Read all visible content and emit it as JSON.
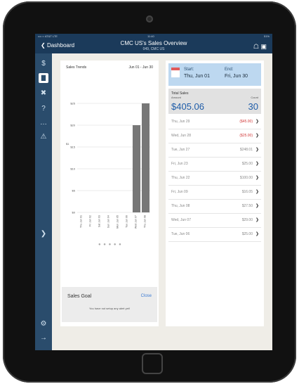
{
  "status_bar": {
    "carrier": "•••○○ AT&T  LTE",
    "time": "11:40",
    "battery": "51%"
  },
  "nav": {
    "back_label": "Dashboard",
    "title": "CMC US's Sales Overview",
    "subtitle": "049, CMC US",
    "icons": [
      "network-icon",
      "export-icon"
    ]
  },
  "sidebar": {
    "items": [
      "dollar-icon",
      "chart-icon",
      "tools-icon",
      "help-icon",
      "more-icon",
      "alert-icon",
      "settings-icon",
      "logout-icon"
    ]
  },
  "chart": {
    "title": "Sales Trends",
    "range": "Jun 01 - Jun 30",
    "y_axis_label": "$1"
  },
  "chart_data": {
    "type": "bar",
    "categories": [
      "Thu Jun 01",
      "Fri Jun 02",
      "Sat Jun 03",
      "Sun Jun 04",
      "Mon Jun 05",
      "Tue Jun 06",
      "Wed Jun 07",
      "Thu Jun 08"
    ],
    "values": [
      0,
      0,
      0,
      0,
      0,
      0,
      20,
      25
    ],
    "y_ticks": [
      "$0",
      "$5",
      "$10",
      "$15",
      "$20",
      "$25"
    ],
    "ylim": [
      0,
      30
    ],
    "color": "#777777"
  },
  "sales_goal": {
    "label": "Sales Goal",
    "close_label": "Close",
    "message": "You have not setup any alert yet!"
  },
  "date_range": {
    "start_label": "Start:",
    "start_value": "Thu, Jun 01",
    "end_label": "End:",
    "end_value": "Fri, Jun 30"
  },
  "totals": {
    "label": "Total Sales",
    "amount_label": "Amount",
    "count_label": "Count",
    "amount": "$405.06",
    "count": "30"
  },
  "rows": [
    {
      "date": "Thu, Jun 29",
      "value": "($45.00)",
      "negative": true
    },
    {
      "date": "Wed, Jun 28",
      "value": "($25.00)",
      "negative": true
    },
    {
      "date": "Tue, Jun 27",
      "value": "$248.01",
      "negative": false
    },
    {
      "date": "Fri, Jun 23",
      "value": "$25.00",
      "negative": false
    },
    {
      "date": "Thu, Jun 22",
      "value": "$100.00",
      "negative": false
    },
    {
      "date": "Fri, Jun 09",
      "value": "$16.05",
      "negative": false
    },
    {
      "date": "Thu, Jun 08",
      "value": "$27.50",
      "negative": false
    },
    {
      "date": "Wed, Jun 07",
      "value": "$29.00",
      "negative": false
    },
    {
      "date": "Tue, Jun 06",
      "value": "$25.00",
      "negative": false
    }
  ],
  "colors": {
    "nav_bg": "#1b3a5a",
    "sidebar_bg": "#2a4c6c",
    "accent": "#1e5ca8",
    "negative": "#d23a3a"
  }
}
